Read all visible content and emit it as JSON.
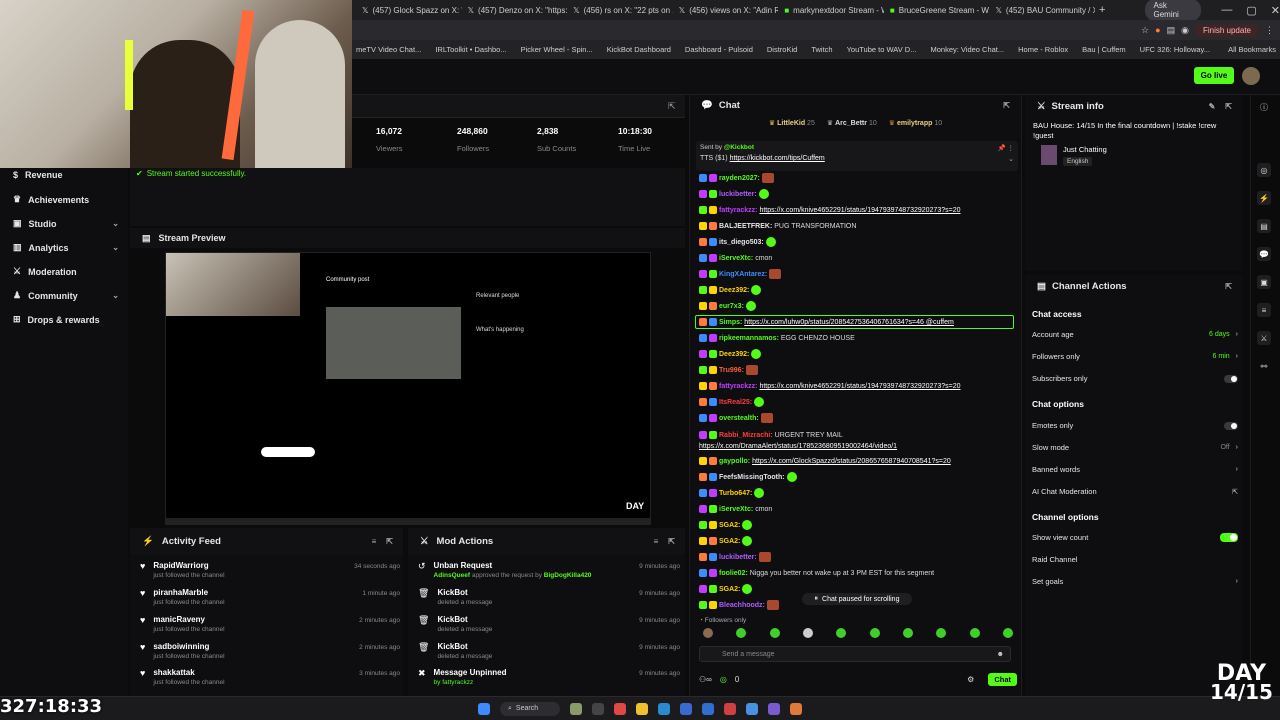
{
  "browser": {
    "tabs": [
      {
        "label": "(457) Glock Spazz on X: \"M"
      },
      {
        "label": "(457) Denzo on X: \"https://"
      },
      {
        "label": "(456) rs on X: \"22 pts on 1"
      },
      {
        "label": "(456) views on X: \"Adin Ro"
      },
      {
        "label": "markynextdoor Stream - W"
      },
      {
        "label": "BruceGreene Stream - Wa"
      },
      {
        "label": "(452) BAU Community / X"
      }
    ],
    "ask_gemini": "Ask Gemini",
    "finish_update": "Finish update",
    "bookmarks": [
      "meTV Video Chat...",
      "IRLToolkit • Dashbo...",
      "Picker Wheel - Spin...",
      "KickBot Dashboard",
      "Dashboard - Pulsoid",
      "DistroKid",
      "Twitch",
      "YouTube to WAV D...",
      "Monkey: Video Chat...",
      "Home - Roblox",
      "Bau | Cuffem",
      "UFC 326: Holloway..."
    ],
    "all_bookmarks": "All Bookmarks"
  },
  "header": {
    "go_live": "Go live"
  },
  "sidebar": {
    "items": [
      {
        "label": "Revenue"
      },
      {
        "label": "Achievements"
      },
      {
        "label": "Studio"
      },
      {
        "label": "Analytics"
      },
      {
        "label": "Moderation"
      },
      {
        "label": "Community"
      },
      {
        "label": "Drops & rewards"
      }
    ]
  },
  "stats": [
    {
      "value": "16,072",
      "label": "Viewers"
    },
    {
      "value": "248,860",
      "label": "Followers"
    },
    {
      "value": "2,838",
      "label": "Sub Counts"
    },
    {
      "value": "10:18:30",
      "label": "Time Live"
    }
  ],
  "toast": "Stream started successfully.",
  "preview": {
    "title": "Stream Preview",
    "community_post": "Community post",
    "relevant_people": "Relevant people",
    "whats_happening": "What's happening",
    "day_label": "DAY"
  },
  "activity_feed": {
    "title": "Activity Feed",
    "items": [
      {
        "name": "RapidWarriorg",
        "desc": "just followed the channel",
        "time": "34 seconds ago"
      },
      {
        "name": "piranhaMarble",
        "desc": "just followed the channel",
        "time": "1 minute ago"
      },
      {
        "name": "manicRaveny",
        "desc": "just followed the channel",
        "time": "2 minutes ago"
      },
      {
        "name": "sadboiwinning",
        "desc": "just followed the channel",
        "time": "2 minutes ago"
      },
      {
        "name": "shakkattak",
        "desc": "just followed the channel",
        "time": "3 minutes ago"
      }
    ]
  },
  "mod_actions": {
    "title": "Mod Actions",
    "items": [
      {
        "name": "Unban Request",
        "desc_pre": "AdinsQueef",
        "desc_mid": " approved the request by ",
        "desc_post": "BigDogKilla420",
        "time": "9 minutes ago"
      },
      {
        "name": "KickBot",
        "desc": "deleted a message",
        "time": "9 minutes ago"
      },
      {
        "name": "KickBot",
        "desc": "deleted a message",
        "time": "9 minutes ago"
      },
      {
        "name": "KickBot",
        "desc": "deleted a message",
        "time": "9 minutes ago"
      },
      {
        "name": "Message Unpinned",
        "desc": "by fattyrackzz",
        "time": "9 minutes ago"
      }
    ]
  },
  "chat": {
    "title": "Chat",
    "gifters": [
      {
        "name": "LittleKid",
        "count": "25"
      },
      {
        "name": "Arc_Bettr",
        "count": "10"
      },
      {
        "name": "emilytrapp",
        "count": "10"
      }
    ],
    "pinned": {
      "sent_by": "Sent by",
      "sender": "@Kickbot",
      "tts": "TTS ($1)",
      "link": "https://kickbot.com/tips/Cuffem"
    },
    "messages": [
      {
        "user": "rayden2027:",
        "color": "#53fc18",
        "text": ""
      },
      {
        "user": "luckibetter:",
        "color": "#b05cff",
        "text": ""
      },
      {
        "user": "fattyrackzz:",
        "color": "#c23cff",
        "text": "https://x.com/knive4652291/status/1947939748732920273?s=20"
      },
      {
        "user": "BALJEETFREK:",
        "color": "#e6e6e6",
        "text": "PUG TRANSFORMATION"
      },
      {
        "user": "its_diego503:",
        "color": "#e6e6e6",
        "text": ""
      },
      {
        "user": "iServeXtc:",
        "color": "#53fc18",
        "text": "cmon"
      },
      {
        "user": "KingXAntarez:",
        "color": "#3c8cff",
        "text": ""
      },
      {
        "user": "Deez392:",
        "color": "#ffd400",
        "text": ""
      },
      {
        "user": "eur7x3:",
        "color": "#53fc18",
        "text": ""
      },
      {
        "user": "Simps:",
        "color": "#53fc18",
        "text": "https://x.com/luhw0p/status/2085427536406761634?s=46 @cuffem"
      },
      {
        "user": "ripkeemannamos:",
        "color": "#53fc18",
        "text": "EGG CHENZO HOUSE"
      },
      {
        "user": "Deez392:",
        "color": "#ffd400",
        "text": ""
      },
      {
        "user": "Tru996:",
        "color": "#ff5a3c",
        "text": ""
      },
      {
        "user": "fattyrackzz:",
        "color": "#c23cff",
        "text": "https://x.com/knive4652291/status/1947939748732920273?s=20"
      },
      {
        "user": "ItsReal25:",
        "color": "#ff3c3c",
        "text": ""
      },
      {
        "user": "overstealth:",
        "color": "#53fc18",
        "text": ""
      },
      {
        "user": "Rabbi_Mizrachi:",
        "color": "#ff3c3c",
        "text": "URGENT TREY MAIL"
      },
      {
        "user": "",
        "color": "#e6e6e6",
        "text": "https://x.com/DramaAlert/status/1785236809519002464/video/1"
      },
      {
        "user": "gaypollo:",
        "color": "#53fc18",
        "text": "https://x.com/GlockSpazzd/status/2086576587940708541?s=20"
      },
      {
        "user": "FeefsMissingTooth:",
        "color": "#e6e6e6",
        "text": ""
      },
      {
        "user": "Turbo647:",
        "color": "#ffd400",
        "text": ""
      },
      {
        "user": "iServeXtc:",
        "color": "#53fc18",
        "text": "cmon"
      },
      {
        "user": "SGA2:",
        "color": "#ffd400",
        "text": ""
      },
      {
        "user": "SGA2:",
        "color": "#ffd400",
        "text": ""
      },
      {
        "user": "luckibetter:",
        "color": "#b05cff",
        "text": ""
      },
      {
        "user": "foolie02:",
        "color": "#53fc18",
        "text": "Nigga you better not wake up at 3 PM EST for this segment"
      },
      {
        "user": "SGA2:",
        "color": "#ffd400",
        "text": ""
      },
      {
        "user": "Bleachhoodz:",
        "color": "#b05cff",
        "text": ""
      }
    ],
    "paused": "Chat paused for scrolling",
    "followers_only": "Followers only",
    "send_placeholder": "Send a message",
    "count": "0",
    "chat_button": "Chat"
  },
  "stream_info": {
    "title": "Stream info",
    "stream_title": "BAU House: 14/15 In the final countdown | !stake !crew !guest",
    "category": "Just Chatting",
    "language": "English"
  },
  "channel_actions": {
    "title": "Channel Actions",
    "chat_access": "Chat access",
    "account_age": {
      "label": "Account age",
      "value": "6 days"
    },
    "followers_only": {
      "label": "Followers only",
      "value": "6 min"
    },
    "subscribers_only": "Subscribers only",
    "chat_options": "Chat options",
    "emotes_only": "Emotes only",
    "slow_mode": {
      "label": "Slow mode",
      "value": "Off"
    },
    "banned_words": "Banned words",
    "ai_moderation": "AI Chat Moderation",
    "channel_options": "Channel options",
    "show_view_count": "Show view count",
    "raid_channel": "Raid Channel",
    "set_goals": "Set goals"
  },
  "overlay": {
    "timer": "327:18:33",
    "day": "DAY",
    "day_num": "14/15"
  },
  "taskbar": {
    "search": "Search"
  },
  "colors": {
    "accent": "#53fc18",
    "background": "#0e0e10"
  }
}
